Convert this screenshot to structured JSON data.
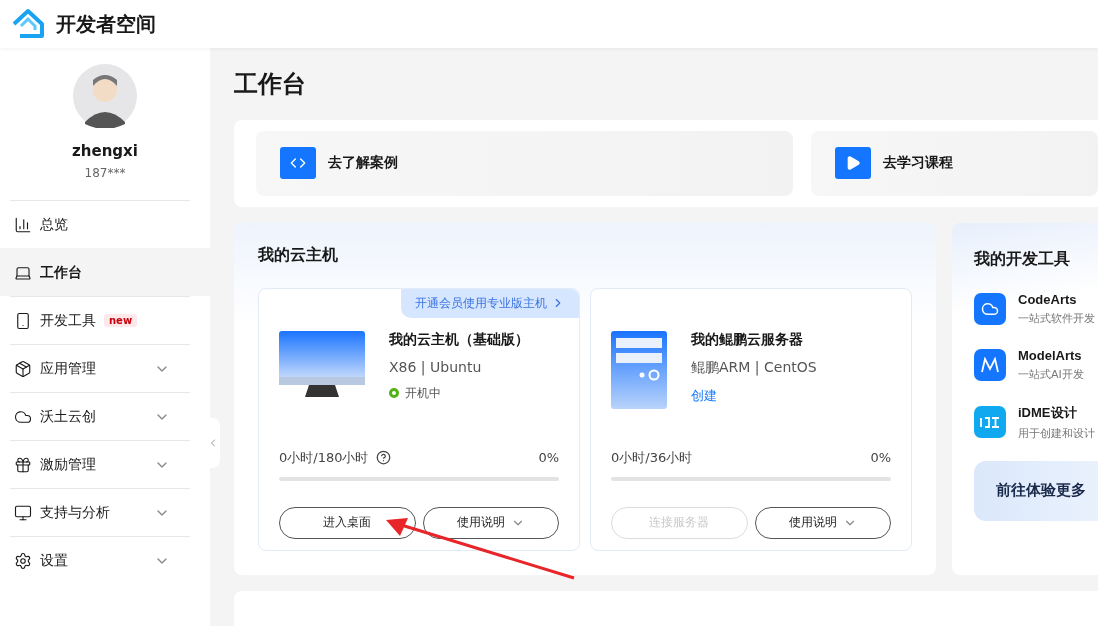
{
  "header": {
    "title": "开发者空间"
  },
  "profile": {
    "name": "zhengxi",
    "phone": "187***"
  },
  "nav": [
    {
      "label": "总览",
      "selected": false,
      "expandable": false
    },
    {
      "label": "工作台",
      "selected": true,
      "expandable": false
    },
    {
      "label": "开发工具",
      "selected": false,
      "expandable": false,
      "badge": "new"
    },
    {
      "label": "应用管理",
      "selected": false,
      "expandable": true
    },
    {
      "label": "沃土云创",
      "selected": false,
      "expandable": true
    },
    {
      "label": "激励管理",
      "selected": false,
      "expandable": true
    },
    {
      "label": "支持与分析",
      "selected": false,
      "expandable": true
    },
    {
      "label": "设置",
      "selected": false,
      "expandable": true
    }
  ],
  "page_title": "工作台",
  "quick_links": [
    {
      "label": "去了解案例"
    },
    {
      "label": "去学习课程"
    }
  ],
  "cloud_section": {
    "title": "我的云主机",
    "hosts": [
      {
        "kind": "desktop",
        "promo": "开通会员使用专业版主机",
        "name": "我的云主机（基础版）",
        "spec": "X86 | Ubuntu",
        "status": "开机中",
        "usage": "0小时/180小时",
        "help": true,
        "percent": "0%",
        "level": 0,
        "primary": {
          "label": "进入桌面",
          "disabled": false
        },
        "secondary": "使用说明"
      },
      {
        "kind": "server",
        "name": "我的鲲鹏云服务器",
        "spec": "鲲鹏ARM | CentOS",
        "link": "创建",
        "usage": "0小时/36小时",
        "help": false,
        "percent": "0%",
        "level": 0,
        "primary": {
          "label": "连接服务器",
          "disabled": true
        },
        "secondary": "使用说明"
      }
    ]
  },
  "dev_tools": {
    "title": "我的开发工具",
    "items": [
      {
        "name": "CodeArts",
        "desc": "一站式软件开发"
      },
      {
        "name": "ModelArts",
        "desc": "一站式AI开发"
      },
      {
        "name": "iDME设计",
        "desc": "用于创建和设计"
      }
    ],
    "more": "前往体验更多"
  }
}
